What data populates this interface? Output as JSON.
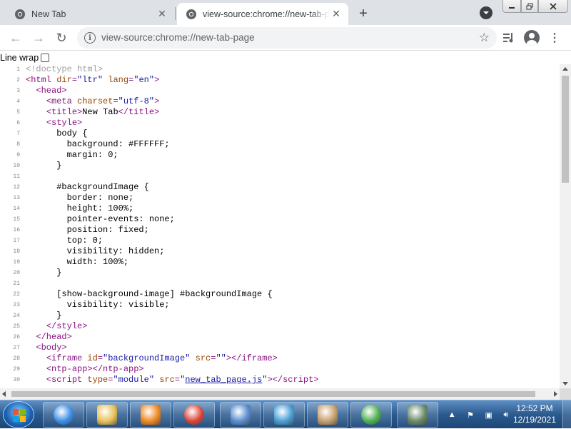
{
  "tabs": [
    {
      "title": "New Tab",
      "active": false
    },
    {
      "title": "view-source:chrome://new-tab-page",
      "active": true
    }
  ],
  "toolbar": {
    "url": "view-source:chrome://new-tab-page"
  },
  "content": {
    "line_wrap_label": "Line wrap",
    "line_wrap_checked": false
  },
  "source_lines": [
    {
      "n": "1",
      "html": "<span class=\"cmt\">&lt;!doctype html&gt;</span>"
    },
    {
      "n": "2",
      "html": "<span class=\"tag\">&lt;html <span class=\"attr\">dir</span>=<span class=\"val\">\"ltr\"</span> <span class=\"attr\">lang</span>=<span class=\"val\">\"en\"</span>&gt;</span>"
    },
    {
      "n": "3",
      "html": "  <span class=\"tag\">&lt;head&gt;</span>"
    },
    {
      "n": "4",
      "html": "    <span class=\"tag\">&lt;meta <span class=\"attr\">charset</span>=<span class=\"val\">\"utf-8\"</span>&gt;</span>"
    },
    {
      "n": "5",
      "html": "    <span class=\"tag\">&lt;title&gt;</span>New Tab<span class=\"tag\">&lt;/title&gt;</span>"
    },
    {
      "n": "6",
      "html": "    <span class=\"tag\">&lt;style&gt;</span>"
    },
    {
      "n": "7",
      "html": "      body {"
    },
    {
      "n": "8",
      "html": "        background: #FFFFFF;"
    },
    {
      "n": "9",
      "html": "        margin: 0;"
    },
    {
      "n": "10",
      "html": "      }"
    },
    {
      "n": "11",
      "html": ""
    },
    {
      "n": "12",
      "html": "      #backgroundImage {"
    },
    {
      "n": "13",
      "html": "        border: none;"
    },
    {
      "n": "14",
      "html": "        height: 100%;"
    },
    {
      "n": "15",
      "html": "        pointer-events: none;"
    },
    {
      "n": "16",
      "html": "        position: fixed;"
    },
    {
      "n": "17",
      "html": "        top: 0;"
    },
    {
      "n": "18",
      "html": "        visibility: hidden;"
    },
    {
      "n": "19",
      "html": "        width: 100%;"
    },
    {
      "n": "20",
      "html": "      }"
    },
    {
      "n": "21",
      "html": ""
    },
    {
      "n": "22",
      "html": "      [show-background-image] #backgroundImage {"
    },
    {
      "n": "23",
      "html": "        visibility: visible;"
    },
    {
      "n": "24",
      "html": "      }"
    },
    {
      "n": "25",
      "html": "    <span class=\"tag\">&lt;/style&gt;</span>"
    },
    {
      "n": "26",
      "html": "  <span class=\"tag\">&lt;/head&gt;</span>"
    },
    {
      "n": "27",
      "html": "  <span class=\"tag\">&lt;body&gt;</span>"
    },
    {
      "n": "28",
      "html": "    <span class=\"tag\">&lt;iframe <span class=\"attr\">id</span>=<span class=\"val\">\"backgroundImage\"</span> <span class=\"attr\">src</span>=<span class=\"val\">\"\"</span>&gt;&lt;/iframe&gt;</span>"
    },
    {
      "n": "29",
      "html": "    <span class=\"tag\">&lt;ntp-app&gt;&lt;/ntp-app&gt;</span>"
    },
    {
      "n": "30",
      "html": "    <span class=\"tag\">&lt;script <span class=\"attr\">type</span>=<span class=\"val\">\"module\"</span> <span class=\"attr\">src</span>=<span class=\"val\">\"<span class=\"link\">new_tab_page.js</span>\"</span>&gt;&lt;/script&gt;</span>"
    }
  ],
  "taskbar": {
    "time": "12:52 PM",
    "date": "12/19/2021",
    "apps": [
      {
        "name": "internet-explorer",
        "color": "#3a8ee6"
      },
      {
        "name": "windows-explorer",
        "color": "#e8c25a"
      },
      {
        "name": "media-player",
        "color": "#f08a24"
      },
      {
        "name": "chrome",
        "color": "#db4437"
      },
      {
        "name": "control-panel",
        "color": "#5b8fd0"
      },
      {
        "name": "photo-viewer",
        "color": "#4aa0d6"
      },
      {
        "name": "paint",
        "color": "#c8a070"
      },
      {
        "name": "windows-update",
        "color": "#4caf50"
      },
      {
        "name": "task-manager",
        "color": "#6a8a6a"
      }
    ]
  }
}
